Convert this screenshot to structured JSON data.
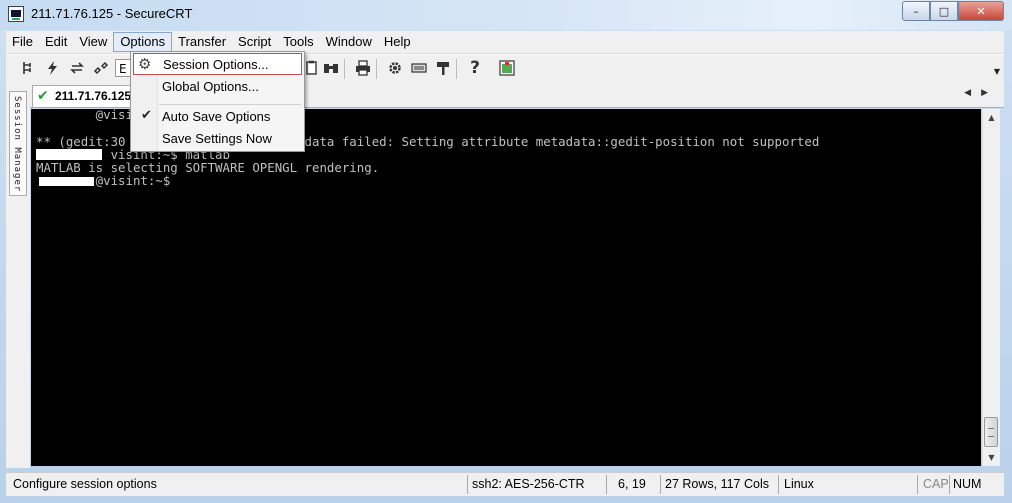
{
  "window": {
    "title": "211.71.76.125 - SecureCRT",
    "controls": {
      "minimize": "–",
      "maximize": "□",
      "close": "✕"
    }
  },
  "menubar": [
    "File",
    "Edit",
    "View",
    "Options",
    "Transfer",
    "Script",
    "Tools",
    "Window",
    "Help"
  ],
  "toolbar": {
    "edit_field_text": "E",
    "icons": [
      "connect-icon",
      "quick-connect-icon",
      "reconnect-icon",
      "disconnect-icon",
      "copy-icon",
      "find-icon",
      "print-icon",
      "settings-icon",
      "keymap-icon",
      "sftp-icon",
      "help-icon",
      "screen-icon"
    ]
  },
  "side_panel": {
    "label": "Session Manager"
  },
  "tabs": [
    {
      "label": "211.71.76.125",
      "status": "connected"
    }
  ],
  "dropdown": {
    "items": [
      {
        "label": "Session Options...",
        "icon": "gear-icon",
        "highlighted": true
      },
      {
        "label": "Global Options...",
        "icon": "",
        "highlighted": false
      },
      {
        "label": "Auto Save Options",
        "icon": "check-icon",
        "checked": true
      },
      {
        "label": "Save Settings Now",
        "icon": "",
        "checked": false
      }
    ]
  },
  "terminal": {
    "lines": [
      "        @visi          ts.txt",
      "** (gedit:30           document metadata failed: Setting attribute metadata::gedit-position not supported",
      "          visint:~$ matlab",
      "MATLAB is selecting SOFTWARE OPENGL rendering.",
      "        @visint:~$"
    ]
  },
  "statusbar": {
    "message": "Configure session options",
    "protocol": "ssh2: AES-256-CTR",
    "cursor": "6,  19",
    "size": "27 Rows, 117 Cols",
    "os": "Linux",
    "cap": "CAP",
    "num": "NUM"
  },
  "colors": {
    "terminal_bg": "#000000",
    "terminal_fg": "#c0c0c0",
    "highlight_border": "#c94b4b",
    "tab_check": "#2a9a2a"
  }
}
